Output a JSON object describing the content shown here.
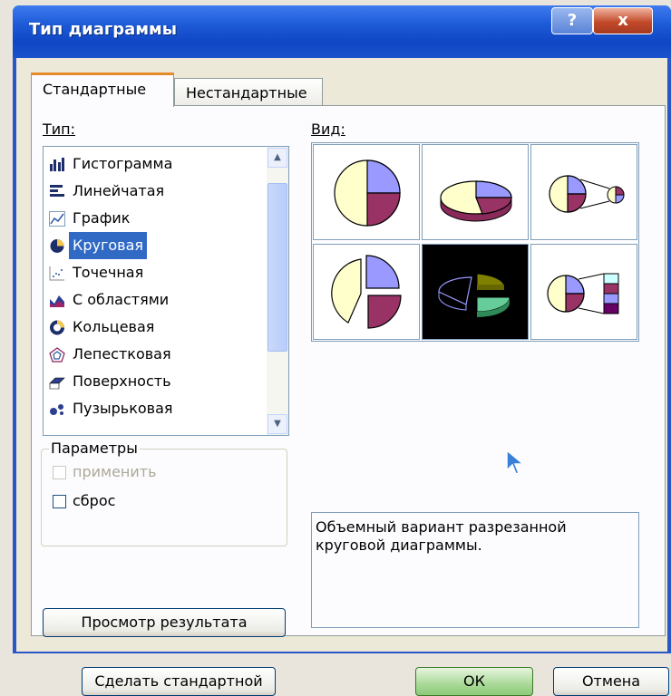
{
  "window": {
    "title": "Тип диаграммы",
    "help_label": "?",
    "close_label": "x"
  },
  "tabs": [
    {
      "label": "Стандартные",
      "active": true
    },
    {
      "label": "Нестандартные",
      "active": false
    }
  ],
  "type_section": {
    "label": "Тип:",
    "items": [
      {
        "label": "Гистограмма",
        "icon": "bar-chart-icon"
      },
      {
        "label": "Линейчатая",
        "icon": "horizontal-bar-icon"
      },
      {
        "label": "График",
        "icon": "line-chart-icon"
      },
      {
        "label": "Круговая",
        "icon": "pie-chart-icon",
        "selected": true
      },
      {
        "label": "Точечная",
        "icon": "scatter-chart-icon"
      },
      {
        "label": "С областями",
        "icon": "area-chart-icon"
      },
      {
        "label": "Кольцевая",
        "icon": "doughnut-chart-icon"
      },
      {
        "label": "Лепестковая",
        "icon": "radar-chart-icon"
      },
      {
        "label": "Поверхность",
        "icon": "surface-chart-icon"
      },
      {
        "label": "Пузырьковая",
        "icon": "bubble-chart-icon"
      }
    ]
  },
  "view_section": {
    "label": "Вид:",
    "selected_index": 4
  },
  "options": {
    "label": "Параметры",
    "apply_label": "применить",
    "reset_label": "сброс"
  },
  "preview_button": "Просмотр результата",
  "description": "Объемный вариант разрезанной круговой диаграммы.",
  "footer": {
    "default_label": "Сделать стандартной",
    "ok_label": "ОК",
    "cancel_label": "Отмена"
  },
  "colors": {
    "selection": "#316ac5",
    "title_bar": "#1e5bd7",
    "pie_cream": "#ffffcc",
    "pie_lavender": "#9999ff",
    "pie_maroon": "#993366"
  }
}
